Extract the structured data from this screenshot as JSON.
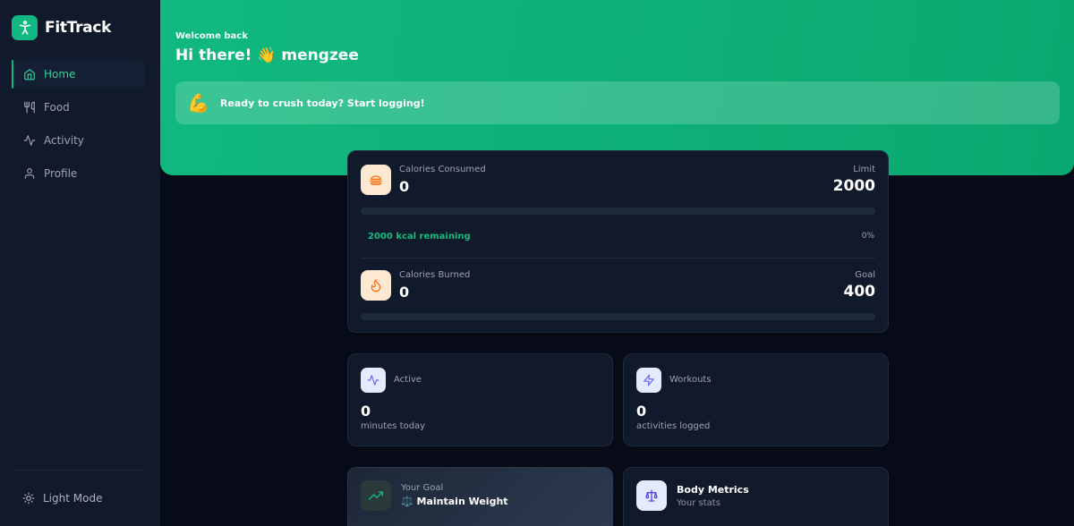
{
  "app": {
    "name": "FitTrack",
    "logo_icon": "person-icon",
    "accent": "#10b981"
  },
  "sidebar": {
    "items": [
      {
        "label": "Home",
        "icon": "home-icon",
        "active": true
      },
      {
        "label": "Food",
        "icon": "utensils-icon",
        "active": false
      },
      {
        "label": "Activity",
        "icon": "activity-icon",
        "active": false
      },
      {
        "label": "Profile",
        "icon": "user-icon",
        "active": false
      }
    ],
    "theme_toggle": {
      "label": "Light Mode",
      "icon": "sun-icon"
    }
  },
  "hero": {
    "welcome": "Welcome back",
    "greeting": "Hi there! 👋 mengzee",
    "banner": {
      "emoji": "💪",
      "text": "Ready to crush today? Start logging!"
    }
  },
  "calories": {
    "consumed": {
      "label": "Calories Consumed",
      "value": "0",
      "right_label": "Limit",
      "right_value": "2000",
      "progress": 0,
      "remaining": "2000 kcal remaining",
      "percent": "0%",
      "icon": "burger-icon"
    },
    "burned": {
      "label": "Calories Burned",
      "value": "0",
      "right_label": "Goal",
      "right_value": "400",
      "progress": 0,
      "icon": "flame-icon"
    }
  },
  "stats": {
    "active": {
      "label": "Active",
      "value": "0",
      "sub": "minutes today",
      "icon": "activity-icon"
    },
    "workouts": {
      "label": "Workouts",
      "value": "0",
      "sub": "activities logged",
      "icon": "zap-icon"
    }
  },
  "goal": {
    "label": "Your Goal",
    "value": "⚖️ Maintain Weight",
    "icon": "trending-up-icon"
  },
  "body_metrics": {
    "title": "Body Metrics",
    "sub": "Your stats",
    "icon": "scale-icon"
  }
}
